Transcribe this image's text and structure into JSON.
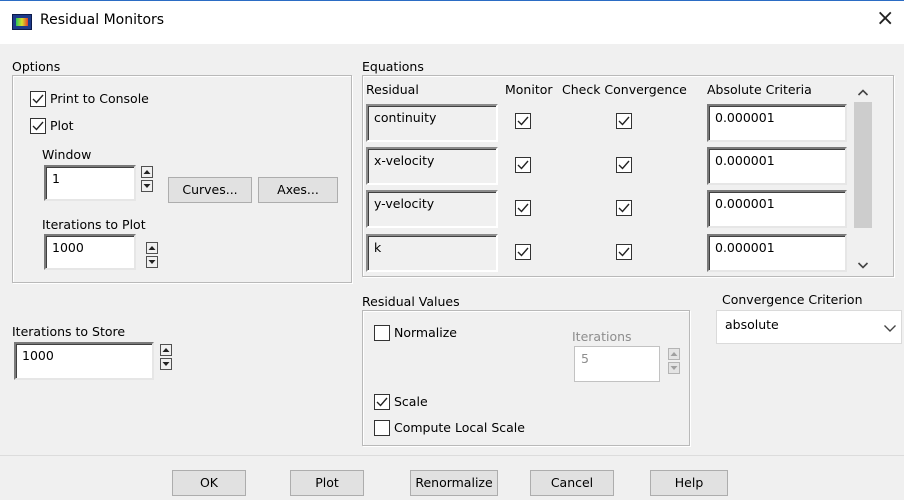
{
  "window": {
    "title": "Residual Monitors",
    "close_glyph": "×"
  },
  "options": {
    "group_label": "Options",
    "print_to_console": {
      "label": "Print to Console",
      "checked": true
    },
    "plot": {
      "label": "Plot",
      "checked": true
    },
    "window_label": "Window",
    "window_value": "1",
    "curves_button": "Curves...",
    "axes_button": "Axes...",
    "iterations_to_plot_label": "Iterations to Plot",
    "iterations_to_plot_value": "1000"
  },
  "store": {
    "label": "Iterations to Store",
    "value": "1000"
  },
  "equations": {
    "group_label": "Equations",
    "headers": {
      "residual": "Residual",
      "monitor": "Monitor",
      "check": "Check Convergence",
      "criteria": "Absolute Criteria"
    },
    "rows": [
      {
        "name": "continuity",
        "monitor": true,
        "check": true,
        "criteria": "0.000001"
      },
      {
        "name": "x-velocity",
        "monitor": true,
        "check": true,
        "criteria": "0.000001"
      },
      {
        "name": "y-velocity",
        "monitor": true,
        "check": true,
        "criteria": "0.000001"
      },
      {
        "name": "k",
        "monitor": true,
        "check": true,
        "criteria": "0.000001"
      }
    ]
  },
  "residual_values": {
    "group_label": "Residual Values",
    "normalize": {
      "label": "Normalize",
      "checked": false
    },
    "iterations_label": "Iterations",
    "iterations_value": "5",
    "scale": {
      "label": "Scale",
      "checked": true
    },
    "compute_local_scale": {
      "label": "Compute Local Scale",
      "checked": false
    }
  },
  "convergence_criterion": {
    "label": "Convergence Criterion",
    "selected": "absolute"
  },
  "buttons": {
    "ok": "OK",
    "plot": "Plot",
    "renormalize": "Renormalize",
    "cancel": "Cancel",
    "help": "Help"
  },
  "icons": {
    "title": "fluent-app-icon",
    "close": "close-icon",
    "checkbox": "check-mark-icon",
    "spin_up": "arrow-up-icon",
    "spin_down": "arrow-down-icon",
    "scroll_up": "chevron-up-icon",
    "scroll_down": "chevron-down-icon",
    "dropdown": "chevron-down-icon"
  },
  "colors": {
    "titlebar_border": "#2b6cc4",
    "dialog_bg": "#f0f0f0"
  }
}
